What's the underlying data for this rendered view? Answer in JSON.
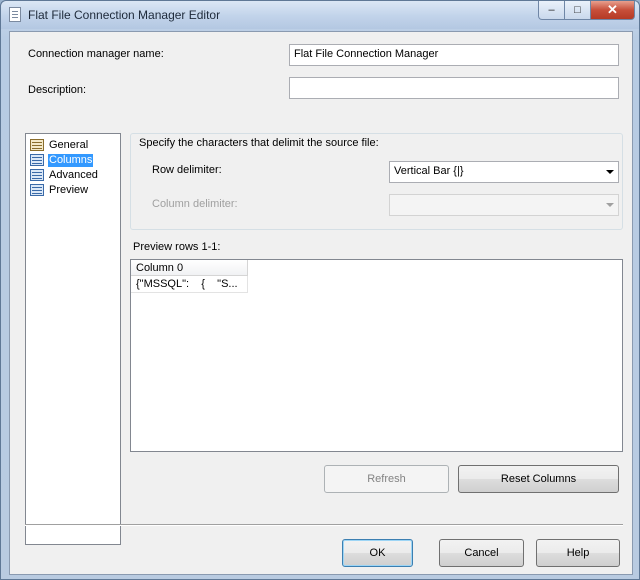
{
  "window": {
    "title": "Flat File Connection Manager Editor",
    "controls": {
      "minimize": "–",
      "maximize": "□",
      "close": "✕"
    }
  },
  "form": {
    "name_label": "Connection manager name:",
    "name_value": "Flat File Connection Manager",
    "description_label": "Description:",
    "description_value": ""
  },
  "nav": {
    "items": [
      {
        "label": "General",
        "icon": "general-icon",
        "selected": false
      },
      {
        "label": "Columns",
        "icon": "columns-icon",
        "selected": true
      },
      {
        "label": "Advanced",
        "icon": "advanced-icon",
        "selected": false
      },
      {
        "label": "Preview",
        "icon": "preview-icon",
        "selected": false
      }
    ]
  },
  "columns": {
    "group_title": "Specify the characters that delimit the source file:",
    "row_delimiter_label": "Row delimiter:",
    "row_delimiter_value": "Vertical Bar {|}",
    "column_delimiter_label": "Column delimiter:",
    "column_delimiter_value": "",
    "preview_label": "Preview rows 1-1:",
    "preview_table": {
      "headers": [
        "Column 0"
      ],
      "rows": [
        [
          "{\"MSSQL\":    {    \"S..."
        ]
      ]
    }
  },
  "buttons": {
    "refresh": "Refresh",
    "reset_columns": "Reset Columns",
    "ok": "OK",
    "cancel": "Cancel",
    "help": "Help"
  },
  "colors": {
    "selection": "#3399ff",
    "window_frame": "#b9cbe1",
    "close_button": "#c74f3a"
  }
}
